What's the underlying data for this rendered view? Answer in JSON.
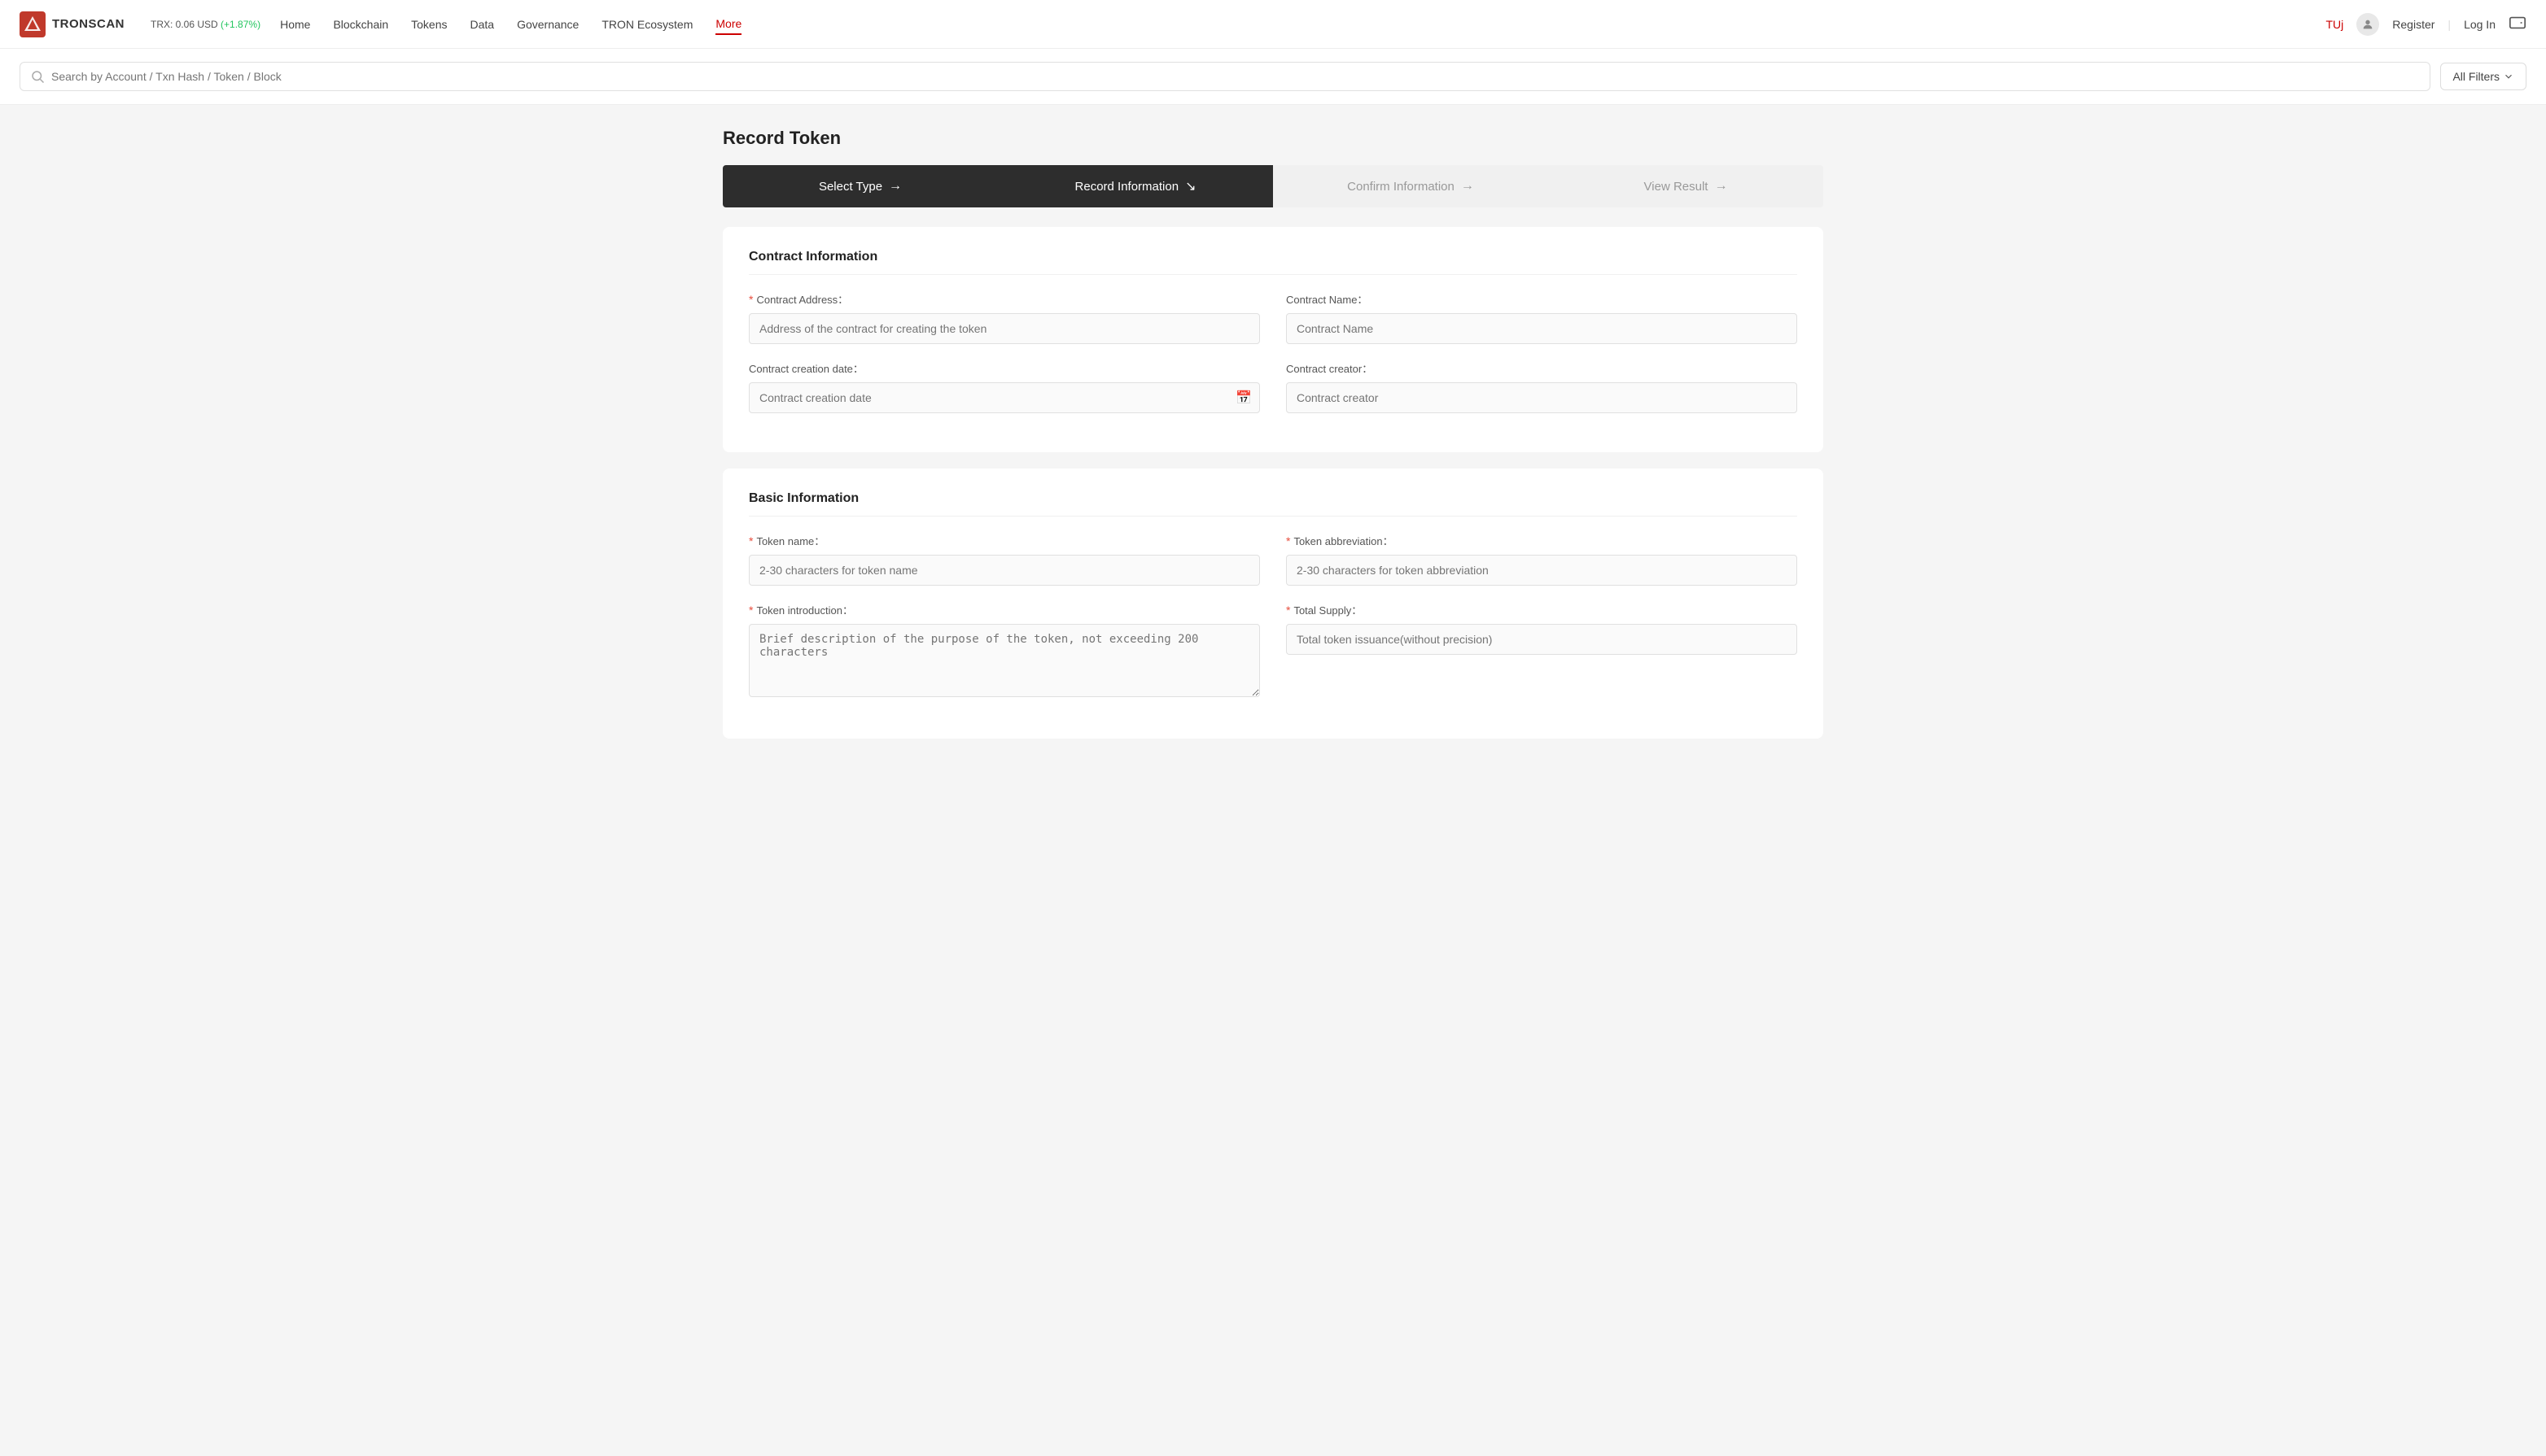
{
  "header": {
    "logo_text": "TRONSCAN",
    "trx_price": "TRX: 0.06 USD",
    "trx_change": "(+1.87%)",
    "nav_items": [
      "Home",
      "Blockchain",
      "Tokens",
      "Data",
      "Governance",
      "TRON Ecosystem",
      "More"
    ],
    "active_nav": "More",
    "user_label": "TUj",
    "register_label": "Register",
    "login_label": "Log In",
    "all_filters_label": "All Filters"
  },
  "search": {
    "placeholder": "Search by Account / Txn Hash / Token / Block"
  },
  "page": {
    "title": "Record Token"
  },
  "steps": [
    {
      "label": "Select Type",
      "arrow": "→",
      "state": "active"
    },
    {
      "label": "Record Information",
      "arrow": "↘",
      "state": "active"
    },
    {
      "label": "Confirm Information",
      "arrow": "→",
      "state": "inactive"
    },
    {
      "label": "View Result",
      "arrow": "→",
      "state": "inactive"
    }
  ],
  "contract_section": {
    "title": "Contract Information",
    "fields": [
      {
        "label": "Contract Address：",
        "required": true,
        "placeholder": "Address of the contract for creating the token",
        "type": "input",
        "name": "contract-address"
      },
      {
        "label": "Contract Name：",
        "required": false,
        "placeholder": "Contract Name",
        "type": "input",
        "name": "contract-name"
      },
      {
        "label": "Contract creation date：",
        "required": false,
        "placeholder": "Contract creation date",
        "type": "date",
        "name": "contract-creation-date"
      },
      {
        "label": "Contract creator：",
        "required": false,
        "placeholder": "Contract creator",
        "type": "input",
        "name": "contract-creator"
      }
    ]
  },
  "basic_section": {
    "title": "Basic Information",
    "fields": [
      {
        "label": "Token name：",
        "required": true,
        "placeholder": "2-30 characters for token name",
        "type": "input",
        "name": "token-name"
      },
      {
        "label": "Token abbreviation：",
        "required": true,
        "placeholder": "2-30 characters for token abbreviation",
        "type": "input",
        "name": "token-abbreviation"
      },
      {
        "label": "Token introduction：",
        "required": true,
        "placeholder": "Brief description of the purpose of the token, not exceeding 200 characters",
        "type": "textarea",
        "name": "token-introduction"
      },
      {
        "label": "Total Supply：",
        "required": true,
        "placeholder": "Total token issuance(without precision)",
        "type": "input",
        "name": "total-supply"
      }
    ]
  }
}
